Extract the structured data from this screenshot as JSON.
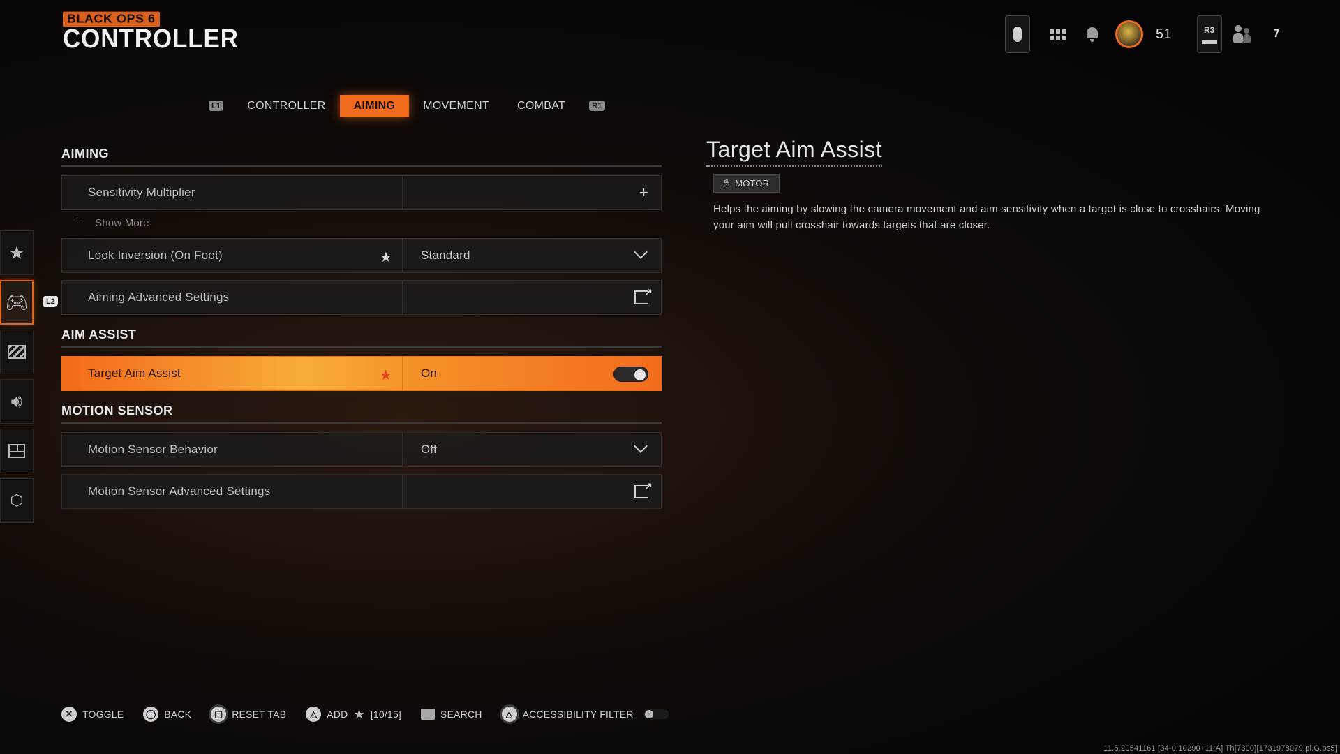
{
  "header": {
    "brand_sub": "BLACK OPS 6",
    "title": "CONTROLLER"
  },
  "status": {
    "menu_icon": "pill-menu-icon",
    "level": "51",
    "r3_label": "R3",
    "friends_count": "7"
  },
  "tabs": {
    "left_bumper": "L1",
    "right_bumper": "R1",
    "items": [
      {
        "label": "CONTROLLER",
        "active": false
      },
      {
        "label": "AIMING",
        "active": true
      },
      {
        "label": "MOVEMENT",
        "active": false
      },
      {
        "label": "COMBAT",
        "active": false
      }
    ]
  },
  "sidebar": {
    "items": [
      {
        "icon": "star-icon",
        "active": false
      },
      {
        "icon": "gamepad-icon",
        "active": true
      },
      {
        "icon": "display-icon",
        "active": false
      },
      {
        "icon": "speaker-icon",
        "active": false
      },
      {
        "icon": "interface-icon",
        "active": false
      },
      {
        "icon": "network-icon",
        "active": false
      }
    ],
    "l2_badge": "L2"
  },
  "sections": {
    "aiming": {
      "title": "AIMING",
      "sensitivity": {
        "label": "Sensitivity Multiplier",
        "action": "+"
      },
      "show_more": "Show More",
      "look_inversion": {
        "label": "Look Inversion (On Foot)",
        "value": "Standard"
      },
      "advanced": {
        "label": "Aiming Advanced Settings"
      }
    },
    "aim_assist": {
      "title": "AIM ASSIST",
      "target": {
        "label": "Target Aim Assist",
        "value": "On",
        "enabled": true
      }
    },
    "motion_sensor": {
      "title": "MOTION SENSOR",
      "behavior": {
        "label": "Motion Sensor Behavior",
        "value": "Off"
      },
      "advanced": {
        "label": "Motion Sensor Advanced Settings"
      }
    }
  },
  "description": {
    "title": "Target Aim Assist",
    "tag": "MOTOR",
    "text": "Helps the aiming by slowing the camera movement and aim sensitivity when a target is close to crosshairs. Moving your aim will pull crosshair towards targets that are closer."
  },
  "footer": {
    "toggle": "TOGGLE",
    "back": "BACK",
    "reset_tab": "RESET TAB",
    "add": "ADD",
    "favorites_count": "[10/15]",
    "search": "SEARCH",
    "accessibility_filter": "ACCESSIBILITY FILTER",
    "accessibility_enabled": false
  },
  "build_info": "11.5.20541161 [34-0:10290+11:A] Th[7300][1731978079.pl.G.ps5]",
  "colors": {
    "accent": "#f26b1d",
    "highlight_start": "#f46a18",
    "highlight_mid": "#f7ac3a"
  }
}
